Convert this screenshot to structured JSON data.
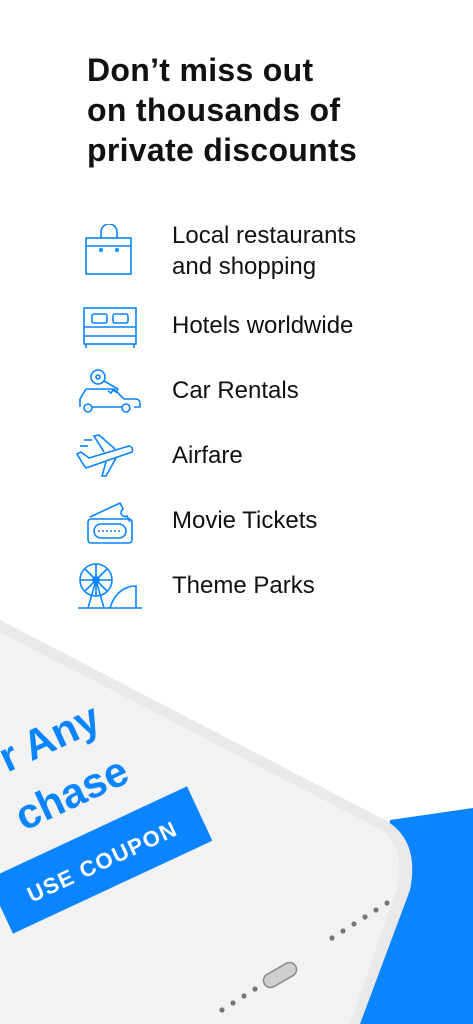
{
  "headline": {
    "line1": "Don’t miss out",
    "line2": "on thousands of",
    "line3": "private discounts"
  },
  "features": [
    {
      "icon": "shopping-bag-icon",
      "line1": "Local restaurants",
      "line2": "and shopping"
    },
    {
      "icon": "bed-icon",
      "line1": "Hotels worldwide",
      "line2": ""
    },
    {
      "icon": "car-key-icon",
      "line1": "Car Rentals",
      "line2": ""
    },
    {
      "icon": "airplane-icon",
      "line1": "Airfare",
      "line2": ""
    },
    {
      "icon": "movie-ticket-icon",
      "line1": "Movie Tickets",
      "line2": ""
    },
    {
      "icon": "ferris-wheel-icon",
      "line1": "Theme Parks",
      "line2": ""
    }
  ],
  "phone": {
    "promo_line1": "r Any",
    "promo_line2": "chase",
    "coupon_button": "USE COUPON"
  },
  "colors": {
    "accent": "#0A84FF",
    "text": "#111111",
    "phone_body": "#EFEFEF"
  }
}
